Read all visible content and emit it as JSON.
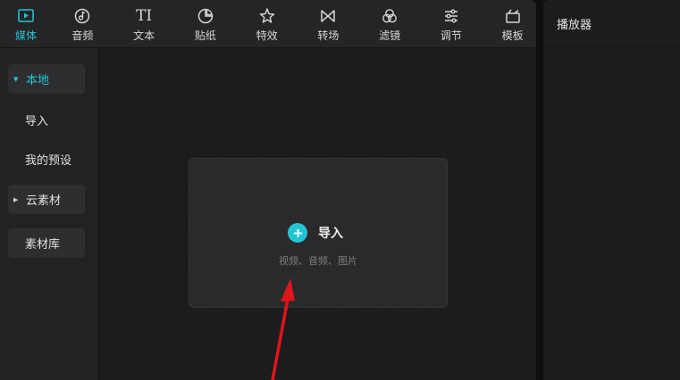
{
  "toolbar": {
    "tabs": [
      {
        "label": "媒体",
        "icon": "media-play-icon",
        "active": true
      },
      {
        "label": "音频",
        "icon": "audio-note-icon",
        "active": false
      },
      {
        "label": "文本",
        "icon": "text-ti-icon",
        "active": false
      },
      {
        "label": "贴纸",
        "icon": "sticker-icon",
        "active": false
      },
      {
        "label": "特效",
        "icon": "effects-star-icon",
        "active": false
      },
      {
        "label": "转场",
        "icon": "transition-bowtie-icon",
        "active": false
      },
      {
        "label": "滤镜",
        "icon": "filter-circles-icon",
        "active": false
      },
      {
        "label": "调节",
        "icon": "adjust-sliders-icon",
        "active": false
      },
      {
        "label": "模板",
        "icon": "template-icon",
        "active": false
      }
    ],
    "text_icon_glyph": "TI"
  },
  "sidebar": {
    "items": [
      {
        "label": "本地",
        "expanded": true,
        "active": true
      },
      {
        "label": "导入"
      },
      {
        "label": "我的预设"
      },
      {
        "label": "云素材",
        "expanded": false
      },
      {
        "label": "素材库"
      }
    ]
  },
  "import_area": {
    "label": "导入",
    "hint": "视频、音频、图片"
  },
  "player": {
    "title": "播放器"
  },
  "colors": {
    "accent": "#22c5d3",
    "arrow": "#e0151b"
  }
}
